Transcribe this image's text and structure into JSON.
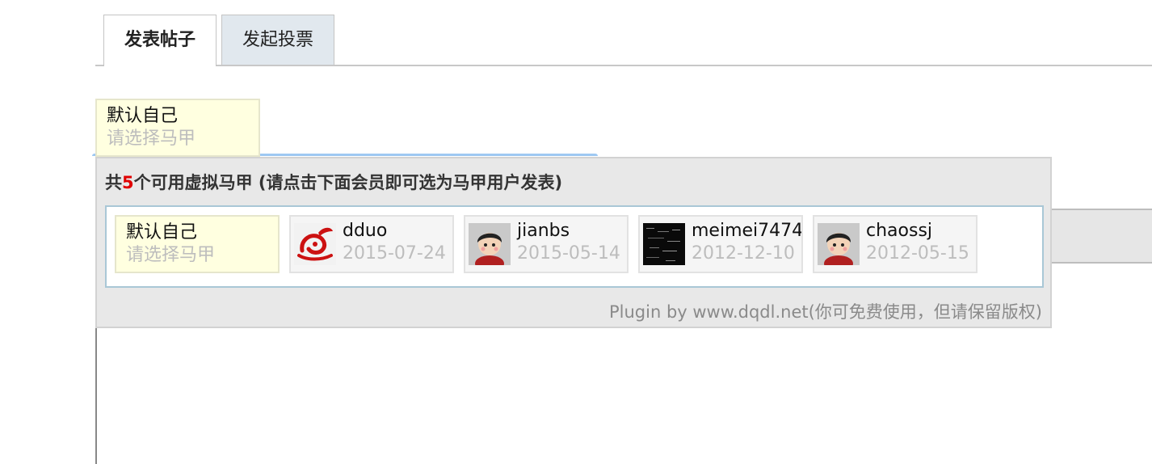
{
  "tabs": [
    {
      "label": "发表帖子",
      "active": true
    },
    {
      "label": "发起投票",
      "active": false
    }
  ],
  "current_identity": {
    "name": "默认自己",
    "hint": "请选择马甲"
  },
  "popup": {
    "title_prefix": "共",
    "count": "5",
    "title_suffix": "个可用虚拟马甲 (请点击下面会员即可选为马甲用户发表)",
    "default_option": {
      "name": "默认自己",
      "hint": "请选择马甲"
    },
    "members": [
      {
        "name": "dduo",
        "date": "2015-07-24",
        "avatar": "red-rabbit-logo-icon"
      },
      {
        "name": "jianbs",
        "date": "2015-05-14",
        "avatar": "cartoon-boy-avatar-icon"
      },
      {
        "name": "meimei7474",
        "date": "2012-12-10",
        "avatar": "dark-noise-avatar-icon"
      },
      {
        "name": "chaossj",
        "date": "2012-05-15",
        "avatar": "cartoon-boy-avatar-icon"
      }
    ],
    "footer": "Plugin by www.dqdl.net(你可免费使用，但请保留版权)"
  },
  "colors": {
    "count": "#e00000",
    "highlight_card": "#ffffe0",
    "inactive_tab": "#e1e8ee",
    "popup_bg": "#e8e8e8",
    "list_border": "#a9c7d6"
  }
}
